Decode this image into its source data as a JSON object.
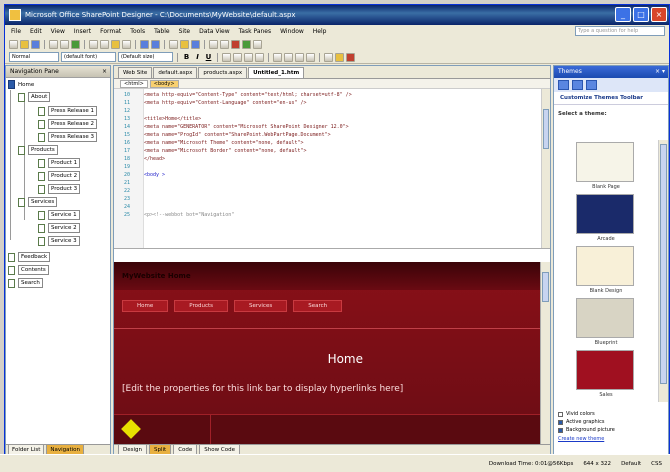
{
  "window": {
    "title": "Microsoft Office SharePoint Designer - C:\\Documents\\MyWebsite\\default.aspx",
    "controls": [
      "_",
      "□",
      "×"
    ]
  },
  "menu": {
    "items": [
      "File",
      "Edit",
      "View",
      "Insert",
      "Format",
      "Tools",
      "Table",
      "Site",
      "Data View",
      "Task Panes",
      "Window",
      "Help"
    ],
    "help_placeholder": "Type a question for help"
  },
  "toolbar": {
    "style_value": "Normal",
    "font_value": "(default font)",
    "size_value": "(Default size)",
    "bold": "B",
    "italic": "I",
    "underline": "U"
  },
  "navpane": {
    "title": "Navigation Pane",
    "close": "×",
    "nodes": [
      {
        "label": "Home",
        "level": 0
      },
      {
        "label": "About",
        "level": 1
      },
      {
        "label": "Press Release 1",
        "level": 2
      },
      {
        "label": "Press Release 2",
        "level": 2
      },
      {
        "label": "Press Release 3",
        "level": 2
      },
      {
        "label": "Products",
        "level": 1
      },
      {
        "label": "Product 1",
        "level": 2
      },
      {
        "label": "Product 2",
        "level": 2
      },
      {
        "label": "Product 3",
        "level": 2
      },
      {
        "label": "Services",
        "level": 1
      },
      {
        "label": "Service 1",
        "level": 2
      },
      {
        "label": "Service 2",
        "level": 2
      },
      {
        "label": "Service 3",
        "level": 2
      },
      {
        "label": "Feedback",
        "level": 1
      },
      {
        "label": "Contents",
        "level": 1
      },
      {
        "label": "Search",
        "level": 1
      }
    ],
    "tabs": [
      "Folder List",
      "Navigation"
    ]
  },
  "editor": {
    "tabs": [
      "Web Site",
      "default.aspx",
      "products.aspx",
      "Untitled_1.htm"
    ],
    "active_tab": 3,
    "breadcrumbs": [
      "<html>",
      "<body>"
    ],
    "code_lines": [
      {
        "num": "10",
        "text": "<meta http-equiv=\"Content-Type\" content=\"text/html; charset=utf-8\" />",
        "kind": "red"
      },
      {
        "num": "11",
        "text": "<meta http-equiv=\"Content-Language\" content=\"en-us\" />",
        "kind": "red"
      },
      {
        "num": "12",
        "text": "",
        "kind": "red"
      },
      {
        "num": "13",
        "text": "<title>Home</title>",
        "kind": "red"
      },
      {
        "num": "14",
        "text": "<meta name=\"GENERATOR\" content=\"Microsoft SharePoint Designer 12.0\">",
        "kind": "red"
      },
      {
        "num": "15",
        "text": "<meta name=\"ProgId\" content=\"SharePoint.WebPartPage.Document\">",
        "kind": "red"
      },
      {
        "num": "16",
        "text": "<meta name=\"Microsoft Theme\" content=\"none, default\">",
        "kind": "red"
      },
      {
        "num": "17",
        "text": "<meta name=\"Microsoft Border\" content=\"none, default\">",
        "kind": "red"
      },
      {
        "num": "18",
        "text": "</head>",
        "kind": "red"
      },
      {
        "num": "19",
        "text": "",
        "kind": "red"
      },
      {
        "num": "20",
        "text": "<body >",
        "kind": "blue"
      },
      {
        "num": "21",
        "text": "",
        "kind": "red"
      },
      {
        "num": "22",
        "text": "",
        "kind": "red"
      },
      {
        "num": "23",
        "text": "",
        "kind": "red"
      },
      {
        "num": "24",
        "text": "",
        "kind": "red"
      },
      {
        "num": "25",
        "text": "<p><!--webbot bot=\"Navigation\"",
        "kind": "gray"
      }
    ],
    "design": {
      "site_title": "MyWebsite Home",
      "nav": [
        "Home",
        "Products",
        "Services",
        "Search"
      ],
      "heading": "Home",
      "note": "[Edit the properties for this link bar to display hyperlinks here]"
    },
    "view_tabs": [
      "Design",
      "Split",
      "Code",
      "Show Code"
    ],
    "active_view": 1
  },
  "rightpane": {
    "title": "Themes",
    "close": "× ▾",
    "subheader": "Customize Themes Toolbar",
    "section": "Select a theme:",
    "themes": [
      {
        "name": "Blank Page",
        "color": "#f6f4e8"
      },
      {
        "name": "Arcade",
        "color": "#1a2a6a"
      },
      {
        "name": "Blank Design",
        "color": "#f8f0d8"
      },
      {
        "name": "Blueprint",
        "color": "#d8d4c4"
      },
      {
        "name": "Sales",
        "color": "#a01020"
      }
    ],
    "options": [
      {
        "label": "Vivid colors",
        "checked": false
      },
      {
        "label": "Active graphics",
        "checked": true
      },
      {
        "label": "Background picture",
        "checked": true
      }
    ],
    "link": "Create new theme"
  },
  "status": {
    "items": [
      "Download Time: 0:01@56Kbps",
      "644 x 322",
      "Default",
      "CSS"
    ]
  },
  "colors": {
    "theme_red": "#8a1018",
    "title_blue": "#0a246a",
    "accent_yellow": "#e8b040"
  }
}
